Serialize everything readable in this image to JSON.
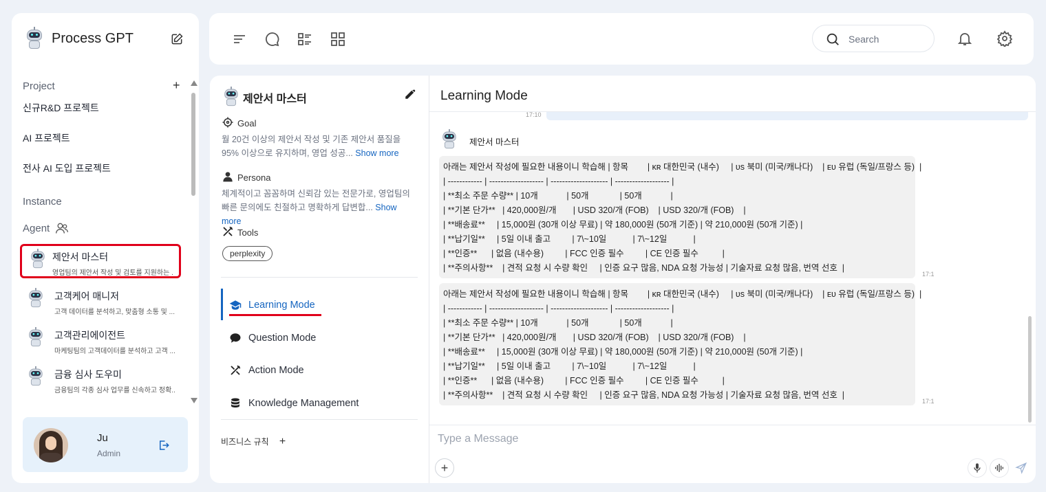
{
  "sidebar": {
    "app_title": "Process GPT",
    "project_label": "Project",
    "projects": [
      "신규R&D 프로젝트",
      "AI 프로젝트",
      "전사 AI 도입 프로젝트"
    ],
    "instance_label": "Instance",
    "agent_label": "Agent",
    "agents": [
      {
        "name": "제안서 마스터",
        "desc": "영업팀의 제안서 작성 및 검토를 지원하는 ..."
      },
      {
        "name": "고객케어 매니저",
        "desc": "고객 데이터를 분석하고, 맞춤형 소통 및 ..."
      },
      {
        "name": "고객관리에이전트",
        "desc": "마케팅팀의 고객데이터를 분석하고 고객 ..."
      },
      {
        "name": "금융 심사 도우미",
        "desc": "금융팀의 각종 심사 업무를 신속하고 정확..."
      }
    ],
    "user": {
      "name": "Ju",
      "role": "Admin"
    }
  },
  "topbar": {
    "search_placeholder": "Search"
  },
  "agent_panel": {
    "title": "제안서 마스터",
    "goal_label": "Goal",
    "goal_text": "월 20건 이상의 제안서 작성 및 기존 제안서 품질을 95% 이상으로 유지하며, 영업 성공...",
    "persona_label": "Persona",
    "persona_text": "체계적이고 꼼꼼하며 신뢰감 있는 전문가로, 영업팀의 빠른 문의에도 친절하고 명확하게 답변합...",
    "show_more": "Show more",
    "tools_label": "Tools",
    "tool_chip": "perplexity",
    "modes": [
      "Learning Mode",
      "Question Mode",
      "Action Mode",
      "Knowledge Management"
    ],
    "rules_label": "비즈니스 규칙"
  },
  "chat": {
    "title": "Learning Mode",
    "prev_time": "17:10",
    "sender": "제안서 마스터",
    "message_lines": [
      "아래는 제안서 작성에 필요한 내용이니 학습해 | 항목        | ᴋʀ 대한민국 (내수)     | ᴜs 북미 (미국/캐나다)    | ᴇᴜ 유럽 (독일/프랑스 등)  |",
      "| ------------ | ------------------- | -------------------- | ------------------- |",
      "| **최소 주문 수량** | 10개            | 50개             | 50개            |",
      "| **기본 단가**   | 420,000원/개       | USD 320/개 (FOB)    | USD 320/개 (FOB)    |",
      "| **배송료**     | 15,000원 (30개 이상 무료) | 약 180,000원 (50개 기준) | 약 210,000원 (50개 기준) |",
      "| **납기일**     | 5일 이내 출고         | 7\\~10일           | 7\\~12일           |",
      "| **인증**      | 없음 (내수용)         | FCC 인증 필수         | CE 인증 필수          |",
      "| **주의사항**    | 견적 요청 시 수량 확인     | 인증 요구 많음, NDA 요청 가능성 | 기술자료 요청 많음, 번역 선호  |"
    ],
    "message_time": "17:1",
    "input_placeholder": "Type a Message"
  }
}
